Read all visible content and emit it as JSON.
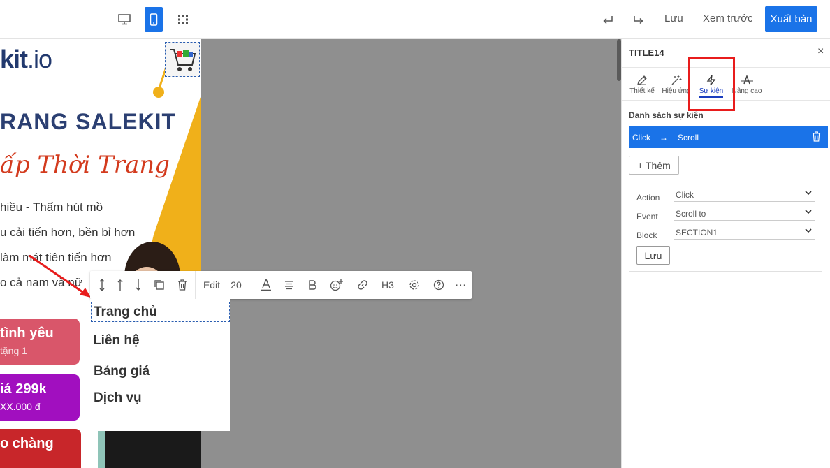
{
  "topbar": {
    "device_icons": [
      "desktop-icon",
      "mobile-icon",
      "qr-code-icon"
    ],
    "undo_icon": "undo-icon",
    "redo_icon": "redo-icon",
    "save_label": "Lưu",
    "preview_label": "Xem trước",
    "publish_label": "Xuất bản"
  },
  "phone": {
    "logo_left": "kit",
    "logo_right": ".io",
    "headline": "RANG SALEKIT",
    "script_title": "ấp Thời Trang",
    "bullets": [
      "hiều - Thấm hút mồ",
      "u cải tiến hơn, bền bỉ hơn",
      " làm mát tiên tiến hơn",
      "o cả nam và nữ"
    ],
    "pills": [
      {
        "big": "tình yêu",
        "small": "tặng 1",
        "color": "#d9566a"
      },
      {
        "big": "iá 299k",
        "small": "XX.000 đ",
        "color": "#a10fbf"
      },
      {
        "big": "o chàng",
        "small": "",
        "color": "#c8262a"
      }
    ]
  },
  "toolbar": {
    "edit_label": "Edit",
    "font_size": "20",
    "heading_label": "H3",
    "icons": [
      "move-vertical-icon",
      "move-up-icon",
      "move-down-icon",
      "duplicate-icon",
      "trash-icon",
      "font-color-icon",
      "align-icon",
      "bold-icon",
      "emoji-add-icon",
      "link-icon",
      "settings-icon",
      "help-icon",
      "more-icon"
    ]
  },
  "menu": {
    "items": [
      "Trang chủ",
      "Liên hệ",
      "Bảng giá",
      "Dịch vụ"
    ]
  },
  "panel": {
    "title": "TITLE14",
    "close": "×",
    "tabs": [
      {
        "label": "Thiết kế",
        "icon": "edit-icon"
      },
      {
        "label": "Hiệu ứng",
        "icon": "magic-wand-icon"
      },
      {
        "label": "Sự kiện",
        "icon": "lightning-icon"
      },
      {
        "label": "Nâng cao",
        "icon": "text-advanced-icon"
      }
    ],
    "events_heading": "Danh sách sự kiện",
    "event": {
      "trigger": "Click",
      "arrow": "→",
      "action": "Scroll"
    },
    "add_label": "+ Thêm",
    "form": {
      "action_label": "Action",
      "action_value": "Click",
      "event_label": "Event",
      "event_value": "Scroll to",
      "block_label": "Block",
      "block_value": "SECTION1",
      "save_label": "Lưu"
    }
  },
  "colors": {
    "accent": "#1a73e8",
    "highlight": "#e81c1c",
    "canvas": "#8f8f8f"
  }
}
